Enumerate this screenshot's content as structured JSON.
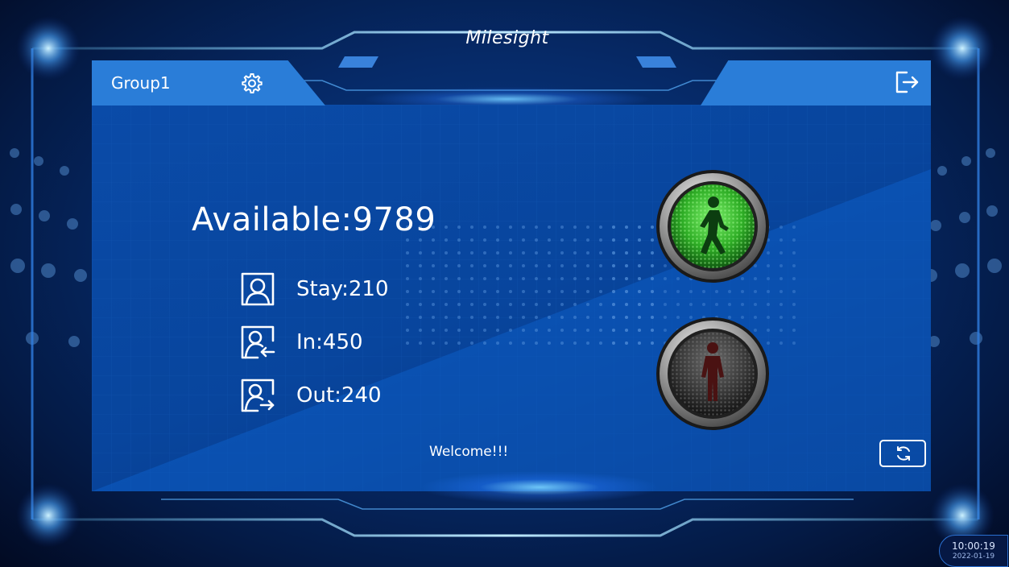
{
  "brand": {
    "name": "Milesight"
  },
  "header": {
    "group_name": "Group1",
    "settings_icon": "gear-icon",
    "logout_icon": "exit-icon"
  },
  "counts": {
    "available_label": "Available:9789",
    "stay_label": "Stay:210",
    "in_label": "In:450",
    "out_label": "Out:240"
  },
  "traffic_light": {
    "green_state": "on",
    "red_state": "off",
    "green_color": "#3ec132",
    "off_color": "#2a2a2a"
  },
  "footer": {
    "welcome_text": "Welcome!!!",
    "refresh_icon": "refresh-icon"
  },
  "clock": {
    "time": "10:00:19",
    "date": "2022-01-19"
  },
  "colors": {
    "accent": "#2a7dd8",
    "panel": "#0a4ba8",
    "text": "#ffffff"
  }
}
